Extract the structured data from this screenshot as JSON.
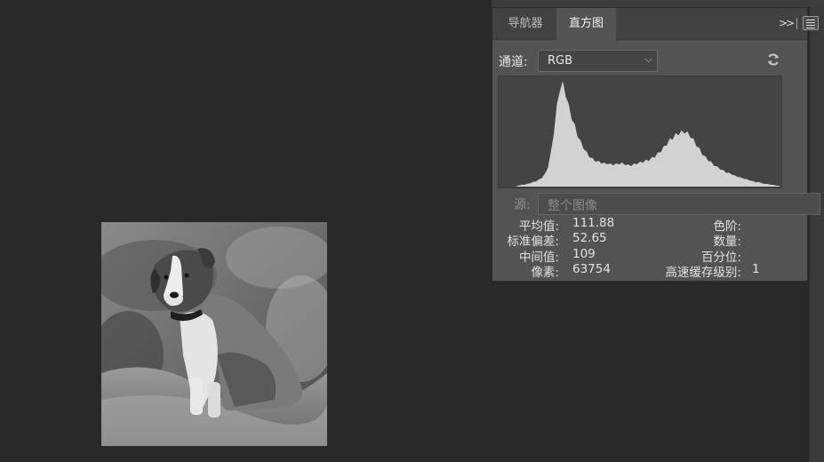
{
  "tabs": [
    {
      "label": "导航器",
      "active": false
    },
    {
      "label": "直方图",
      "active": true
    }
  ],
  "collapse_label": ">>",
  "channel": {
    "label": "通道:",
    "value": "RGB"
  },
  "source": {
    "label": "源:",
    "value": "整个图像"
  },
  "stats_left": [
    {
      "label": "平均值:",
      "value": "111.88"
    },
    {
      "label": "标准偏差:",
      "value": "52.65"
    },
    {
      "label": "中间值:",
      "value": "109"
    },
    {
      "label": "像素:",
      "value": "63754"
    }
  ],
  "stats_right": [
    {
      "label": "色阶:",
      "value": ""
    },
    {
      "label": "数量:",
      "value": ""
    },
    {
      "label": "百分位:",
      "value": ""
    },
    {
      "label": "高速缓存级别:",
      "value": "1"
    }
  ],
  "colors": {
    "canvas_bg": "#282828",
    "panel_bg": "#535353",
    "histogram_fill": "#d2d2d2"
  },
  "histogram_profile": [
    0,
    0,
    0,
    1,
    2,
    2,
    3,
    4,
    5,
    6,
    8,
    10,
    14,
    22,
    38,
    62,
    90,
    110,
    116,
    104,
    90,
    78,
    68,
    58,
    50,
    44,
    38,
    34,
    31,
    29,
    28,
    27,
    26,
    26,
    25,
    25,
    25,
    26,
    26,
    25,
    24,
    24,
    25,
    26,
    27,
    28,
    29,
    30,
    32,
    34,
    37,
    40,
    44,
    48,
    52,
    55,
    58,
    60,
    61,
    62,
    60,
    57,
    52,
    47,
    42,
    37,
    33,
    30,
    27,
    24,
    22,
    20,
    18,
    16,
    15,
    14,
    12,
    11,
    10,
    9,
    8,
    7,
    6,
    5,
    5,
    4,
    3,
    3,
    2,
    2,
    1,
    1
  ]
}
